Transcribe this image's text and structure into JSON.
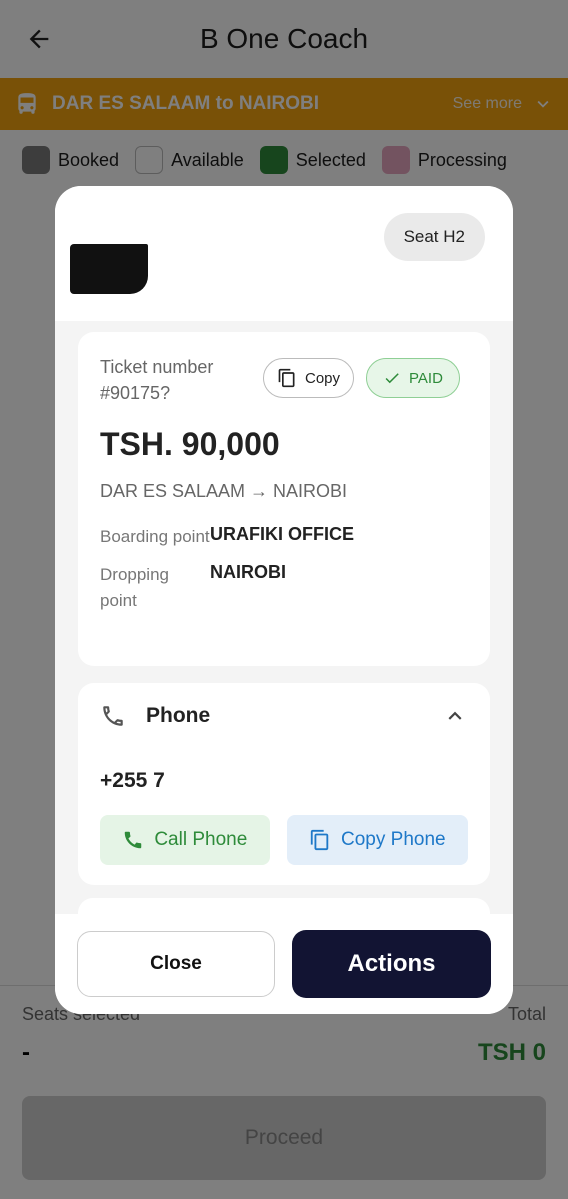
{
  "app": {
    "title": "B One Coach",
    "route": "DAR ES SALAAM to NAIROBI",
    "see_more": "See more",
    "legend": [
      {
        "label": "Booked",
        "color": "#7a7a7a"
      },
      {
        "label": "Available",
        "color": "#ffffff"
      },
      {
        "label": "Selected",
        "color": "#2e8b3a"
      },
      {
        "label": "Processing",
        "color": "#e7a6c0"
      }
    ],
    "bottom": {
      "seats_label": "Seats selected",
      "seats_value": "-",
      "total_label": "Total",
      "total_value": "TSH 0",
      "proceed_label": "Proceed"
    }
  },
  "modal": {
    "seat_chip": "Seat H2",
    "ticket": {
      "number_label": "Ticket number",
      "number_value": "#90175?",
      "copy_label": "Copy",
      "paid_label": "PAID",
      "amount": "TSH. 90,000",
      "route": "DAR ES SALAAM → NAIROBI",
      "boarding_label": "Boarding point",
      "boarding_value": "URAFIKI OFFICE",
      "dropping_label": "Dropping point",
      "dropping_value": "NAIROBI"
    },
    "phone": {
      "title": "Phone",
      "number": "+255 7",
      "call_label": "Call Phone",
      "copy_label": "Copy Phone"
    },
    "footer": {
      "close_label": "Close",
      "actions_label": "Actions"
    }
  },
  "colors": {
    "route_bar": "#f2a20e",
    "paid_green": "#2e8b3a",
    "copy_blue": "#1e78c8",
    "actions_navy": "#121433"
  }
}
